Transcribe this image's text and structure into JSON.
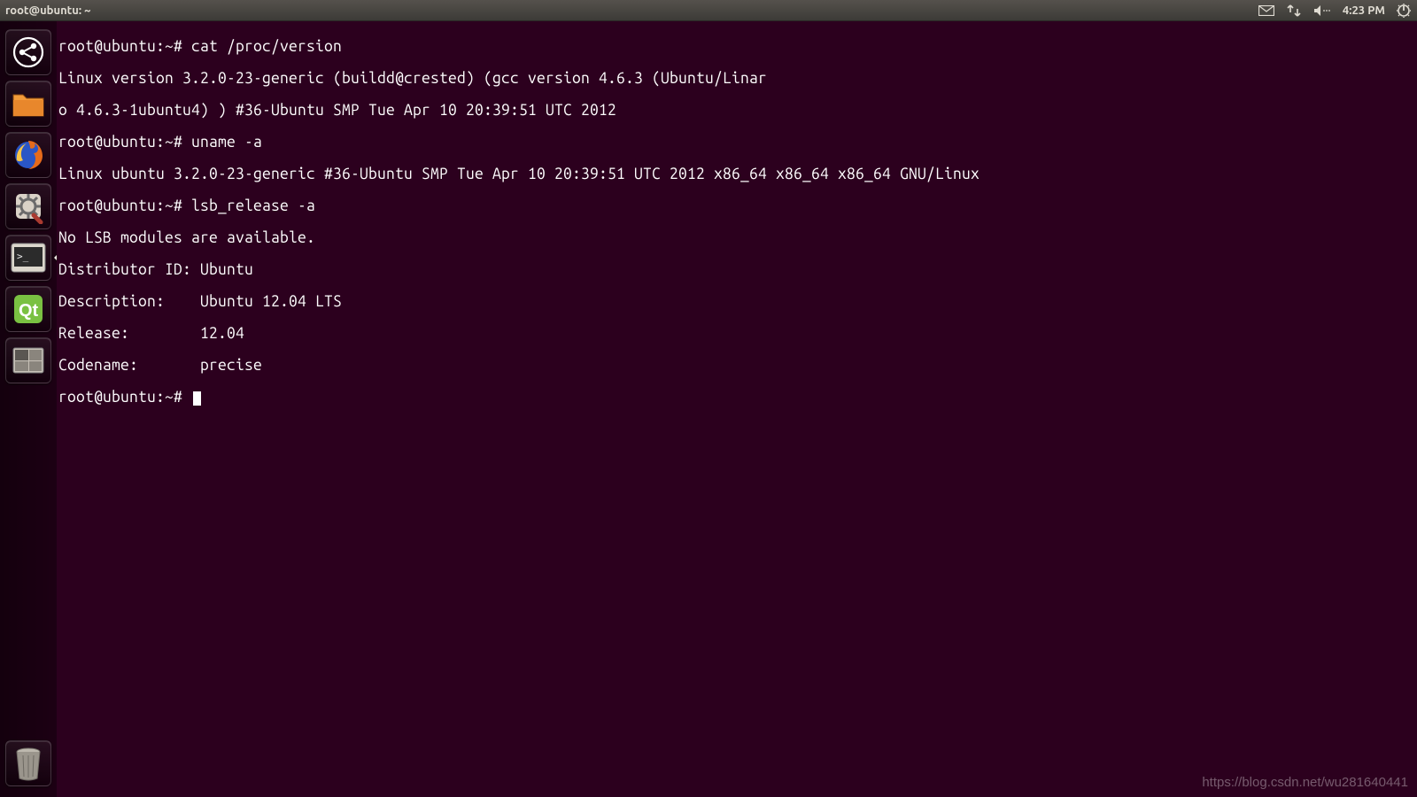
{
  "panel": {
    "title": "root@ubuntu: ~",
    "clock": "4:23 PM"
  },
  "launcher": {
    "items": [
      {
        "name": "dash-home-icon"
      },
      {
        "name": "files-icon"
      },
      {
        "name": "firefox-icon"
      },
      {
        "name": "system-settings-icon"
      },
      {
        "name": "terminal-icon"
      },
      {
        "name": "qt-creator-icon"
      },
      {
        "name": "workspace-switcher-icon"
      }
    ],
    "trash": {
      "name": "trash-icon"
    }
  },
  "terminal": {
    "lines": [
      "root@ubuntu:~# cat /proc/version",
      "Linux version 3.2.0-23-generic (buildd@crested) (gcc version 4.6.3 (Ubuntu/Linar",
      "o 4.6.3-1ubuntu4) ) #36-Ubuntu SMP Tue Apr 10 20:39:51 UTC 2012",
      "root@ubuntu:~# uname -a",
      "Linux ubuntu 3.2.0-23-generic #36-Ubuntu SMP Tue Apr 10 20:39:51 UTC 2012 x86_64 x86_64 x86_64 GNU/Linux",
      "root@ubuntu:~# lsb_release -a",
      "No LSB modules are available.",
      "Distributor ID:\tUbuntu",
      "Description:\tUbuntu 12.04 LTS",
      "Release:\t12.04",
      "Codename:\tprecise"
    ],
    "prompt": "root@ubuntu:~# "
  },
  "watermark": "https://blog.csdn.net/wu281640441"
}
